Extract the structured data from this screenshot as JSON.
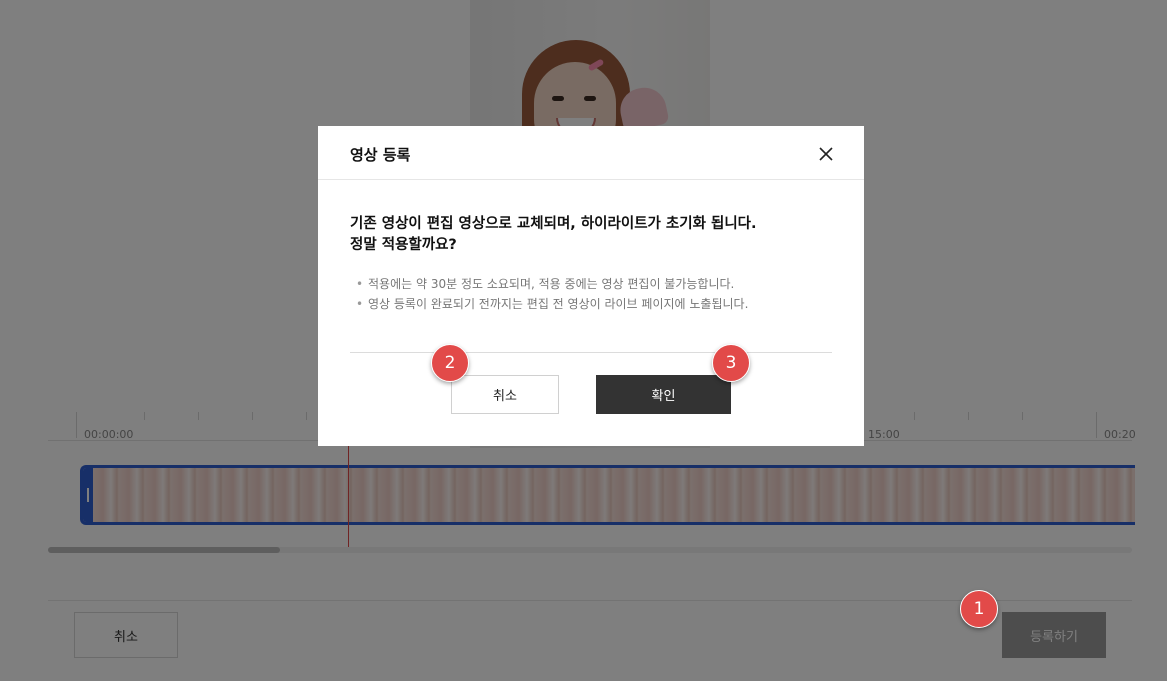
{
  "timeline": {
    "time_labels": [
      "00:00:00",
      "15:00",
      "00:20"
    ]
  },
  "bottom_bar": {
    "cancel_label": "취소",
    "register_label": "등록하기"
  },
  "modal": {
    "title": "영상 등록",
    "question_line1": "기존 영상이 편집 영상으로 교체되며, 하이라이트가 초기화 됩니다.",
    "question_line2": "정말 적용할까요?",
    "notes": [
      "적용에는 약 30분 정도 소요되며, 적용 중에는 영상 편집이 불가능합니다.",
      "영상 등록이 완료되기 전까지는 편집 전 영상이 라이브 페이지에 노출됩니다."
    ],
    "cancel_label": "취소",
    "confirm_label": "확인"
  },
  "badges": [
    "1",
    "2",
    "3"
  ],
  "colors": {
    "accent_badge": "#e24a49",
    "confirm_bg": "#333333",
    "track_border": "#2f5fd0",
    "playhead": "#e04848"
  }
}
